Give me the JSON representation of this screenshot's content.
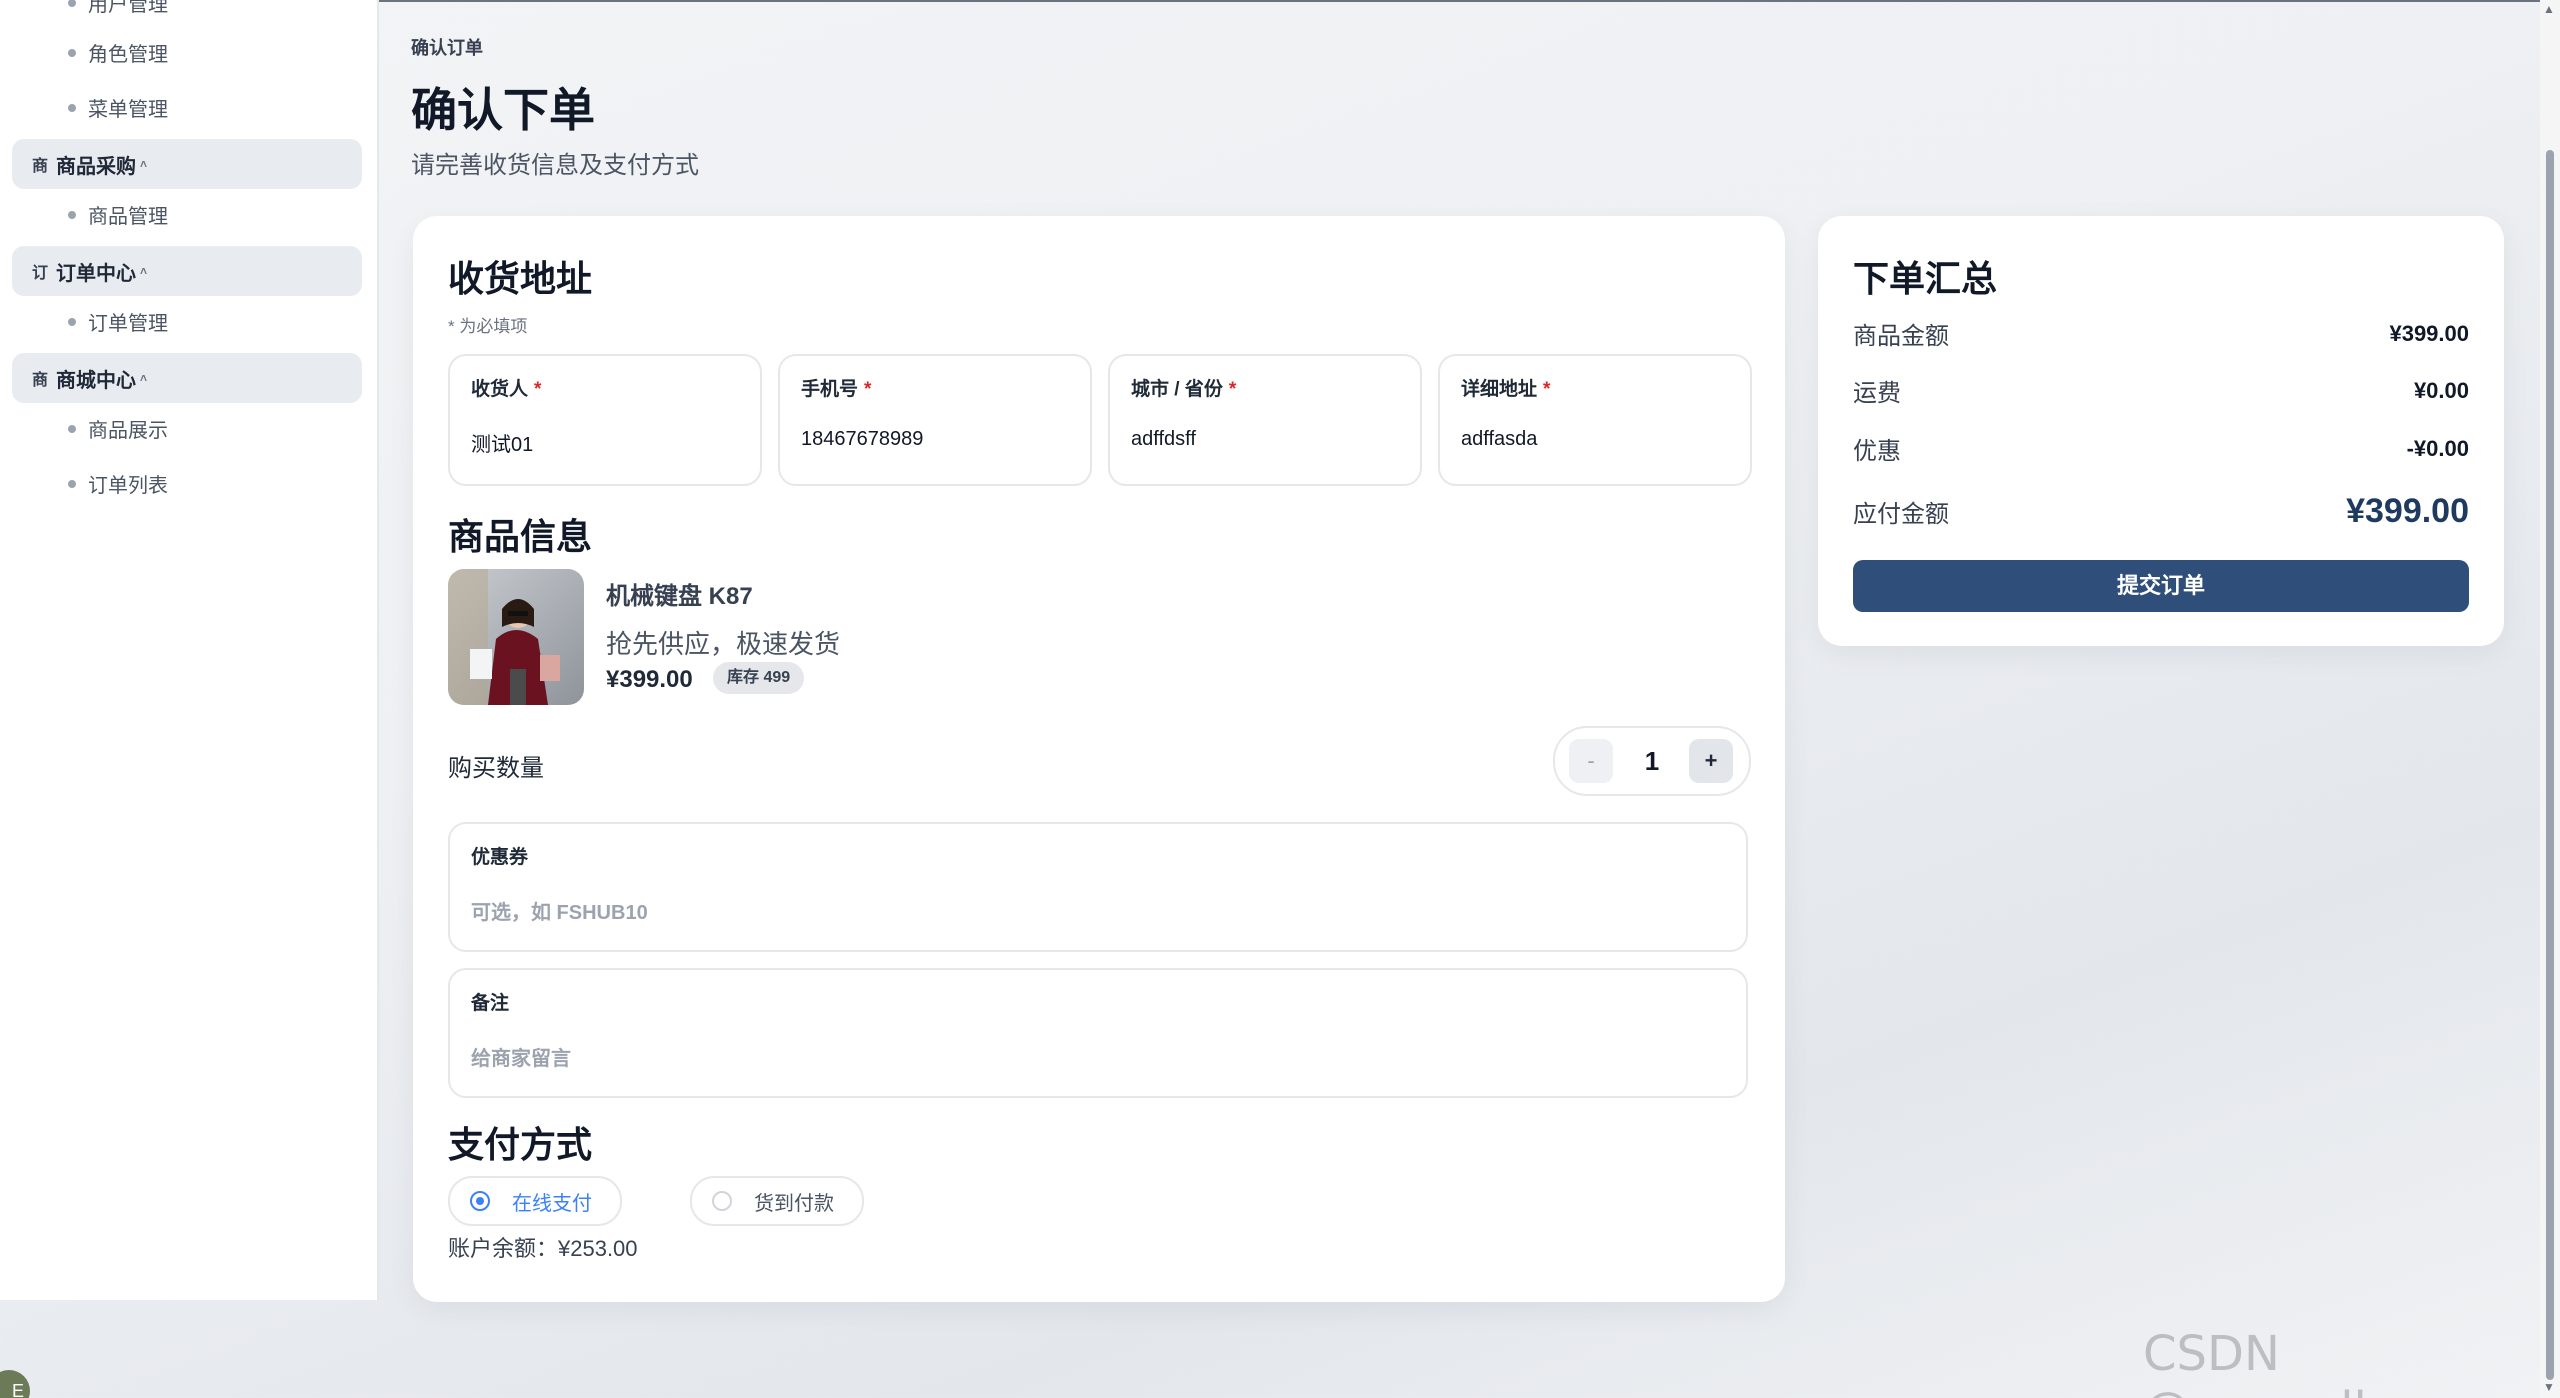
{
  "sidebar": {
    "partial_top_item": "用户管理",
    "items_top": [
      {
        "label": "角色管理"
      },
      {
        "label": "菜单管理"
      }
    ],
    "groups": [
      {
        "icon": "商",
        "label": "商品采购",
        "caret": "˄",
        "children": [
          {
            "label": "商品管理"
          }
        ]
      },
      {
        "icon": "订",
        "label": "订单中心",
        "caret": "˄",
        "children": [
          {
            "label": "订单管理"
          }
        ]
      },
      {
        "icon": "商",
        "label": "商城中心",
        "caret": "˄",
        "children": [
          {
            "label": "商品展示"
          },
          {
            "label": "订单列表"
          }
        ]
      }
    ]
  },
  "header": {
    "breadcrumb": "确认订单",
    "title": "确认下单",
    "subtitle": "请完善收货信息及支付方式"
  },
  "address": {
    "title": "收货地址",
    "required_note": "* 为必填项",
    "fields": [
      {
        "label": "收货人",
        "star": "*",
        "value": "测试01"
      },
      {
        "label": "手机号",
        "star": "*",
        "value": "18467678989"
      },
      {
        "label": "城市 / 省份",
        "star": "*",
        "value": "adffdsff"
      },
      {
        "label": "详细地址",
        "star": "*",
        "value": "adffasda"
      }
    ]
  },
  "product": {
    "title": "商品信息",
    "name": "机械键盘 K87",
    "description": "抢先供应，极速发货",
    "price": "¥399.00",
    "stock": "库存 499",
    "quantity_label": "购买数量",
    "minus": "-",
    "quantity": "1",
    "plus": "+"
  },
  "coupon": {
    "label": "优惠券",
    "placeholder": "可选，如 FSHUB10"
  },
  "remark": {
    "label": "备注",
    "placeholder": "给商家留言"
  },
  "payment": {
    "title": "支付方式",
    "options": [
      {
        "label": "在线支付",
        "selected": true
      },
      {
        "label": "货到付款",
        "selected": false
      }
    ],
    "balance": "账户余额：¥253.00"
  },
  "summary": {
    "title": "下单汇总",
    "rows": [
      {
        "label": "商品金额",
        "value": "¥399.00"
      },
      {
        "label": "运费",
        "value": "¥0.00"
      },
      {
        "label": "优惠",
        "value": "-¥0.00"
      }
    ],
    "total_label": "应付金额",
    "total_value": "¥399.00",
    "submit_label": "提交订单"
  },
  "colors": {
    "accent": "#2f4f7a",
    "radio_selected": "#3b82f6",
    "required_star": "#dc2626"
  },
  "watermark": "CSDN @openallzzz",
  "avatar_letter": "E"
}
